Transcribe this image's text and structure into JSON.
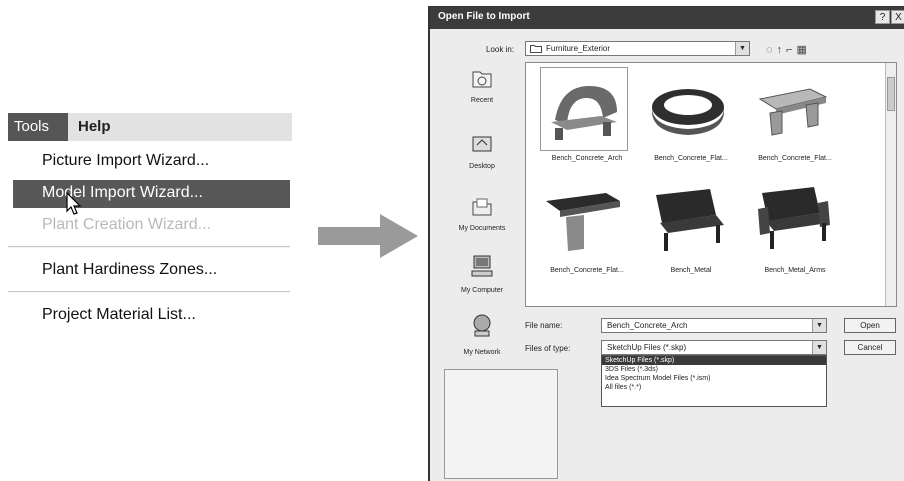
{
  "menu": {
    "bar": [
      "Tools",
      "Help"
    ],
    "items": [
      {
        "label": "Picture Import Wizard...",
        "state": "normal"
      },
      {
        "label": "Model Import Wizard...",
        "state": "highlighted"
      },
      {
        "label": "Plant Creation Wizard...",
        "state": "disabled"
      },
      {
        "label": "Plant Hardiness Zones...",
        "state": "normal"
      },
      {
        "label": "Project Material List...",
        "state": "normal"
      }
    ]
  },
  "dialog": {
    "title": "Open File to Import",
    "look_in_label": "Look in:",
    "look_in_value": "Furniture_Exterior",
    "places": [
      "Recent",
      "Desktop",
      "My Documents",
      "My Computer",
      "My Network"
    ],
    "files": [
      "Bench_Concrete_Arch",
      "Bench_Concrete_Flat...",
      "Bench_Concrete_Flat...",
      "Bench_Concrete_Flat...",
      "Bench_Metal",
      "Bench_Metal_Arms"
    ],
    "file_name_label": "File name:",
    "file_name_value": "Bench_Concrete_Arch",
    "files_of_type_label": "Files of type:",
    "files_of_type_value": "SketchUp Files (*.skp)",
    "type_options": [
      "SketchUp Files (*.skp)",
      "3DS Files (*.3ds)",
      "Idea Spectrum Model Files (*.ism)",
      "All files (*.*)"
    ],
    "open_label": "Open",
    "cancel_label": "Cancel",
    "help_glyph": "?",
    "close_glyph": "X"
  },
  "colors": {
    "highlight": "#585858",
    "title_bar": "#3c3c3c",
    "arrow": "#9a9a9a"
  }
}
